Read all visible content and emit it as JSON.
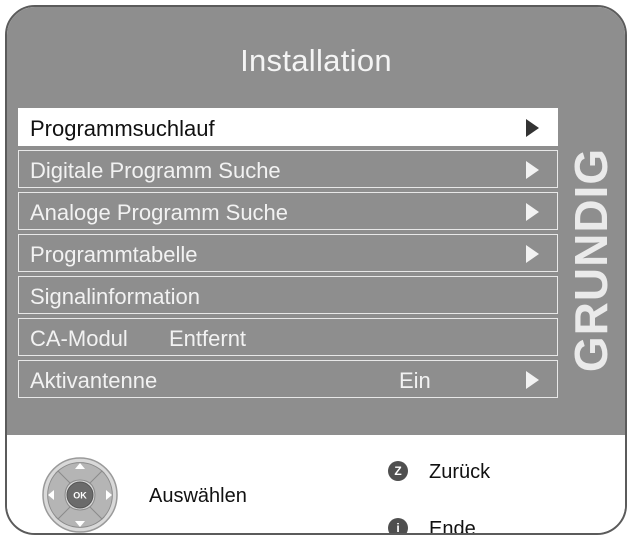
{
  "title": "Installation",
  "menu": {
    "items": [
      {
        "label": "Programmsuchlauf",
        "selected": true,
        "arrow": true
      },
      {
        "label": "Digitale Programm Suche",
        "arrow": true
      },
      {
        "label": "Analoge Programm Suche",
        "arrow": true
      },
      {
        "label": "Programmtabelle",
        "arrow": true
      },
      {
        "label": "Signalinformation",
        "arrow": false
      },
      {
        "label": "CA-Modul",
        "value": "Entfernt",
        "arrow": false
      },
      {
        "label": "Aktivantenne",
        "value": "Ein",
        "arrow": true
      }
    ]
  },
  "brand": "GRUNDIG",
  "footer": {
    "ok_key": "OK",
    "select_label": "Auswählen",
    "back_key": "Z",
    "back_label": "Zurück",
    "end_key": "i",
    "end_label": "Ende"
  },
  "colors": {
    "panel": "#8e8e8e",
    "highlight": "#ffffff",
    "key": "#4f4f4f"
  },
  "icons": [
    "chevron-right-icon",
    "remote-dpad-icon",
    "ok-button-icon",
    "z-key-icon",
    "info-key-icon"
  ]
}
